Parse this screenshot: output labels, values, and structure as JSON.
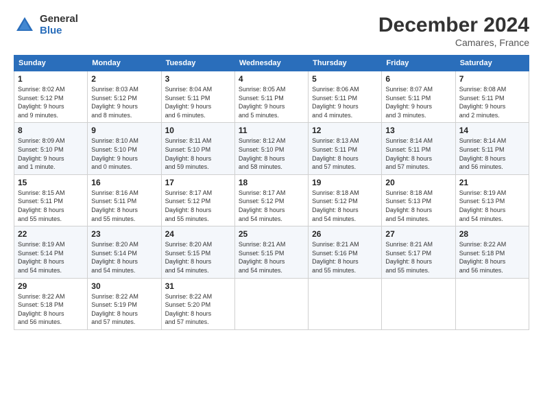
{
  "logo": {
    "general": "General",
    "blue": "Blue"
  },
  "header": {
    "month": "December 2024",
    "location": "Camares, France"
  },
  "weekdays": [
    "Sunday",
    "Monday",
    "Tuesday",
    "Wednesday",
    "Thursday",
    "Friday",
    "Saturday"
  ],
  "weeks": [
    [
      {
        "day": "1",
        "info": "Sunrise: 8:02 AM\nSunset: 5:12 PM\nDaylight: 9 hours\nand 9 minutes."
      },
      {
        "day": "2",
        "info": "Sunrise: 8:03 AM\nSunset: 5:12 PM\nDaylight: 9 hours\nand 8 minutes."
      },
      {
        "day": "3",
        "info": "Sunrise: 8:04 AM\nSunset: 5:11 PM\nDaylight: 9 hours\nand 6 minutes."
      },
      {
        "day": "4",
        "info": "Sunrise: 8:05 AM\nSunset: 5:11 PM\nDaylight: 9 hours\nand 5 minutes."
      },
      {
        "day": "5",
        "info": "Sunrise: 8:06 AM\nSunset: 5:11 PM\nDaylight: 9 hours\nand 4 minutes."
      },
      {
        "day": "6",
        "info": "Sunrise: 8:07 AM\nSunset: 5:11 PM\nDaylight: 9 hours\nand 3 minutes."
      },
      {
        "day": "7",
        "info": "Sunrise: 8:08 AM\nSunset: 5:11 PM\nDaylight: 9 hours\nand 2 minutes."
      }
    ],
    [
      {
        "day": "8",
        "info": "Sunrise: 8:09 AM\nSunset: 5:10 PM\nDaylight: 9 hours\nand 1 minute."
      },
      {
        "day": "9",
        "info": "Sunrise: 8:10 AM\nSunset: 5:10 PM\nDaylight: 9 hours\nand 0 minutes."
      },
      {
        "day": "10",
        "info": "Sunrise: 8:11 AM\nSunset: 5:10 PM\nDaylight: 8 hours\nand 59 minutes."
      },
      {
        "day": "11",
        "info": "Sunrise: 8:12 AM\nSunset: 5:10 PM\nDaylight: 8 hours\nand 58 minutes."
      },
      {
        "day": "12",
        "info": "Sunrise: 8:13 AM\nSunset: 5:11 PM\nDaylight: 8 hours\nand 57 minutes."
      },
      {
        "day": "13",
        "info": "Sunrise: 8:14 AM\nSunset: 5:11 PM\nDaylight: 8 hours\nand 57 minutes."
      },
      {
        "day": "14",
        "info": "Sunrise: 8:14 AM\nSunset: 5:11 PM\nDaylight: 8 hours\nand 56 minutes."
      }
    ],
    [
      {
        "day": "15",
        "info": "Sunrise: 8:15 AM\nSunset: 5:11 PM\nDaylight: 8 hours\nand 55 minutes."
      },
      {
        "day": "16",
        "info": "Sunrise: 8:16 AM\nSunset: 5:11 PM\nDaylight: 8 hours\nand 55 minutes."
      },
      {
        "day": "17",
        "info": "Sunrise: 8:17 AM\nSunset: 5:12 PM\nDaylight: 8 hours\nand 55 minutes."
      },
      {
        "day": "18",
        "info": "Sunrise: 8:17 AM\nSunset: 5:12 PM\nDaylight: 8 hours\nand 54 minutes."
      },
      {
        "day": "19",
        "info": "Sunrise: 8:18 AM\nSunset: 5:12 PM\nDaylight: 8 hours\nand 54 minutes."
      },
      {
        "day": "20",
        "info": "Sunrise: 8:18 AM\nSunset: 5:13 PM\nDaylight: 8 hours\nand 54 minutes."
      },
      {
        "day": "21",
        "info": "Sunrise: 8:19 AM\nSunset: 5:13 PM\nDaylight: 8 hours\nand 54 minutes."
      }
    ],
    [
      {
        "day": "22",
        "info": "Sunrise: 8:19 AM\nSunset: 5:14 PM\nDaylight: 8 hours\nand 54 minutes."
      },
      {
        "day": "23",
        "info": "Sunrise: 8:20 AM\nSunset: 5:14 PM\nDaylight: 8 hours\nand 54 minutes."
      },
      {
        "day": "24",
        "info": "Sunrise: 8:20 AM\nSunset: 5:15 PM\nDaylight: 8 hours\nand 54 minutes."
      },
      {
        "day": "25",
        "info": "Sunrise: 8:21 AM\nSunset: 5:15 PM\nDaylight: 8 hours\nand 54 minutes."
      },
      {
        "day": "26",
        "info": "Sunrise: 8:21 AM\nSunset: 5:16 PM\nDaylight: 8 hours\nand 55 minutes."
      },
      {
        "day": "27",
        "info": "Sunrise: 8:21 AM\nSunset: 5:17 PM\nDaylight: 8 hours\nand 55 minutes."
      },
      {
        "day": "28",
        "info": "Sunrise: 8:22 AM\nSunset: 5:18 PM\nDaylight: 8 hours\nand 56 minutes."
      }
    ],
    [
      {
        "day": "29",
        "info": "Sunrise: 8:22 AM\nSunset: 5:18 PM\nDaylight: 8 hours\nand 56 minutes."
      },
      {
        "day": "30",
        "info": "Sunrise: 8:22 AM\nSunset: 5:19 PM\nDaylight: 8 hours\nand 57 minutes."
      },
      {
        "day": "31",
        "info": "Sunrise: 8:22 AM\nSunset: 5:20 PM\nDaylight: 8 hours\nand 57 minutes."
      },
      null,
      null,
      null,
      null
    ]
  ]
}
